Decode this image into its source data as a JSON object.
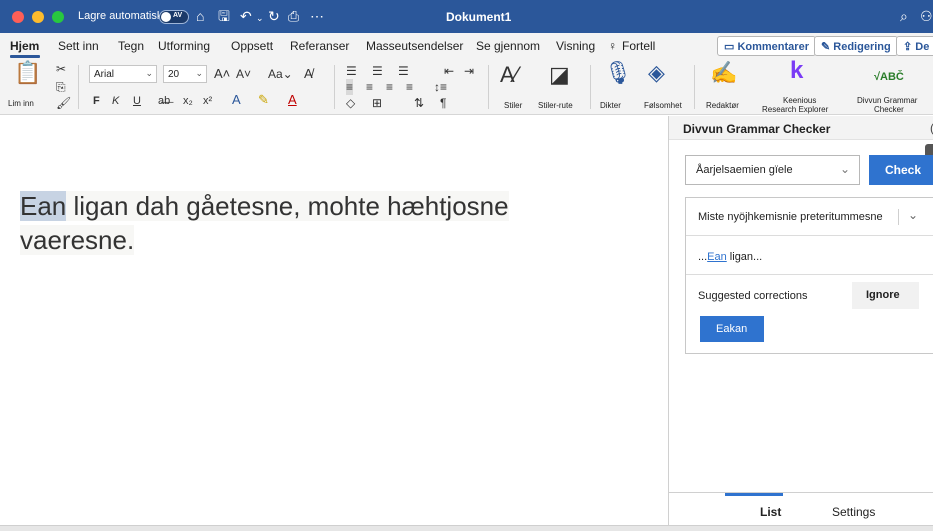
{
  "titlebar": {
    "autosave_label": "Lagre automatisk",
    "autosave_state": "AV",
    "document_title": "Dokument1"
  },
  "tabs": {
    "items": [
      "Hjem",
      "Sett inn",
      "Tegn",
      "Utforming",
      "Oppsett",
      "Referanser",
      "Masseutsendelser",
      "Se gjennom",
      "Visning",
      "Fortell"
    ],
    "active": "Hjem",
    "comments_label": "Kommentarer",
    "editing_label": "Redigering",
    "share_label": "De"
  },
  "ribbon": {
    "paste_label": "Lim inn",
    "font_name": "Arial",
    "font_size": "20",
    "bold": "F",
    "italic": "K",
    "underline": "U",
    "styles_label": "Stiler",
    "styles_pane_label": "Stiler-rute",
    "dictate_label": "Dikter",
    "sensitivity_label": "Følsomhet",
    "editor_label": "Redaktør",
    "keenious_label_1": "Keenious",
    "keenious_label_2": "Research Explorer",
    "divvun_label_1": "Divvun Grammar",
    "divvun_label_2": "Checker",
    "divvun_glyph": "√ABČ"
  },
  "document": {
    "highlighted_word": "Ean",
    "line1_rest": " ligan dah gåetesne, mohte hæhtjosne",
    "line2": "vaeresne."
  },
  "pane": {
    "title": "Divvun Grammar Checker",
    "language": "Åarjelsaemien gïele",
    "check_label": "Check",
    "error_title": "Miste nyöjhkemisnie preteritummesne",
    "context_prefix": "...",
    "context_error": "Ean",
    "context_suffix": " ligan...",
    "suggested_label": "Suggested corrections",
    "ignore_label": "Ignore",
    "suggestion": "Eakan",
    "tab_list": "List",
    "tab_settings": "Settings"
  },
  "colors": {
    "titlebar": "#2b579a",
    "accent": "#2f73cf",
    "highlight": "#c7d3e3"
  }
}
